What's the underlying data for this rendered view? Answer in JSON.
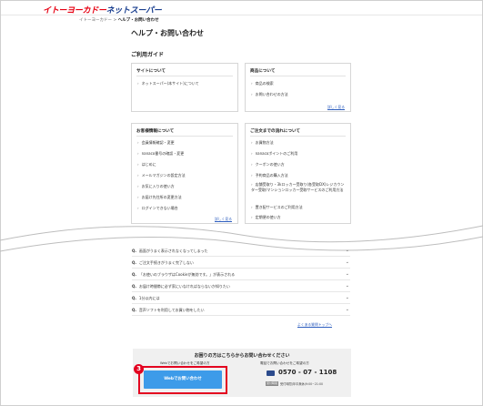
{
  "header": {
    "logo_red": "イトーヨーカドー",
    "logo_blue": "ネットスーパー"
  },
  "breadcrumb": {
    "parent": "イトーヨーカドー",
    "separator": ">",
    "current": "ヘルプ・お問い合わせ"
  },
  "page_title": "ヘルプ・お問い合わせ",
  "guide_title": "ご利用ガイド",
  "boxes": {
    "site": {
      "heading": "サイトについて",
      "items": [
        "ネットスーパー(本サイト)について"
      ]
    },
    "products": {
      "heading": "商品について",
      "items": [
        "商品の検索",
        "お問い合わせの方法"
      ],
      "more": "詳しく見る"
    },
    "member": {
      "heading": "お客様情報について",
      "items": [
        "会員情報確認・変更",
        "nanaco番号の確認・変更",
        "はじめに",
        "メールマガジンの設定方法",
        "お気に入りの使い方",
        "お届け先住所の変更方法",
        "ログインできない場合"
      ],
      "more": "詳しく見る"
    },
    "order": {
      "heading": "ご注文までの流れについて",
      "items": [
        "お買物方法",
        "nanacoポイントのご利用",
        "クーポンの使い方",
        "予約商品の購入方法",
        "店舗受取り・3kロッカー受取り(各受取DX)レジカウンター受取/マンションロッカー受取サービスのご利用方法",
        "置き配サービスのご利用方法",
        "定期便の使い方"
      ],
      "more": "詳しく見る"
    }
  },
  "faq": {
    "prefix": "Q.",
    "items": [
      "画面がうまく表示されなくなってしまった",
      "ご注文手続きがうまく完了しない",
      "「お使いのブラウザはCookieが無効です。」が表示される",
      "お届け時間帯に必ず家にいなければならないか知りたい",
      "1分以内には",
      "音声ソフトを利用してお買い物をしたい"
    ],
    "more": "よくある質問トップへ"
  },
  "contact": {
    "title": "お困りの方はこちらからお問い合わせください",
    "web_note": "Webでお問い合わせをご希望の方",
    "web_button": "Webでお問い合わせ",
    "phone_note": "電話でお問い合わせをご希望の方",
    "phone": "0570 - 07 - 1108",
    "hours_badge": "受付時間",
    "hours": "受付時間(年中無休)9:00~21:00",
    "step_badge": "3"
  },
  "colors": {
    "accent": "#e60012",
    "brand_blue": "#1a3f8f",
    "button": "#3d9be9",
    "link": "#2f5fbf"
  }
}
